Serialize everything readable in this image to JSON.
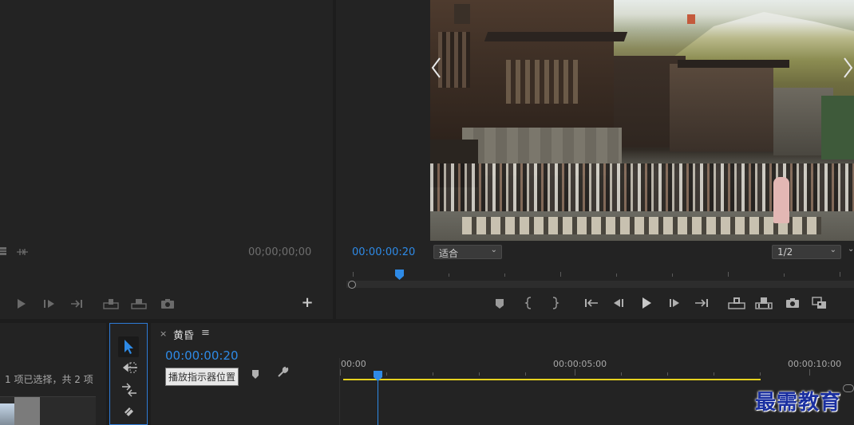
{
  "source": {
    "timecode": "00;00;00;00"
  },
  "program": {
    "timecode": "00:00:00:20",
    "fit_label": "适合",
    "resolution": "1/2"
  },
  "project": {
    "selection_info": "1 项已选择，共 2 项"
  },
  "timeline": {
    "close": "×",
    "sequence_name": "黄昏",
    "menu": "≡",
    "timecode": "00:00:00:20",
    "tooltip": "播放指示器位置",
    "ruler": [
      "00:00",
      "00:00:05:00",
      "00:00:10:00"
    ]
  },
  "watermark": "最需教育",
  "colors": {
    "accent_blue": "#2e8ae6",
    "work_area_yellow": "#e6d21e",
    "watermark_blue": "#1a2fa0"
  },
  "icons": {
    "marker": "marker-icon",
    "in": "mark-in-icon",
    "out": "mark-out-icon",
    "goto_in": "go-to-in-icon",
    "step_back": "step-back-icon",
    "play": "play-icon",
    "step_forward": "step-forward-icon",
    "goto_out": "go-to-out-icon",
    "lift": "lift-icon",
    "extract": "extract-icon",
    "export_frame": "camera-icon",
    "compare": "compare-icon",
    "add": "plus-icon"
  }
}
